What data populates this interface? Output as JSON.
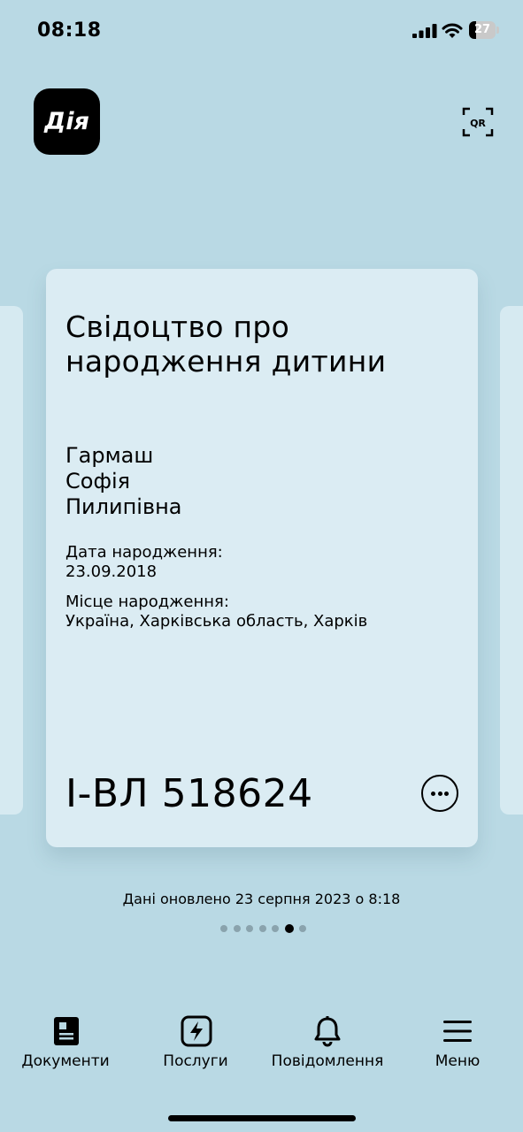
{
  "status_bar": {
    "time": "08:18",
    "battery": "27",
    "battery_level": 0.27
  },
  "header": {
    "logo_text": "Дія",
    "qr_label": "QR"
  },
  "document": {
    "title": "Свідоцтво про народження дитини",
    "surname": "Гармаш",
    "first_name": "Софія",
    "patronymic": "Пилипівна",
    "birth_date_label": "Дата народження:",
    "birth_date": "23.09.2018",
    "birth_place_label": "Місце народження:",
    "birth_place": "Україна, Харківська область, Харків",
    "number": "І-ВЛ 518624"
  },
  "updated_text": "Дані оновлено 23 серпня 2023 о 8:18",
  "pager": {
    "count": 7,
    "active_index": 5
  },
  "nav": {
    "items": [
      {
        "label": "Документи",
        "icon": "documents-icon"
      },
      {
        "label": "Послуги",
        "icon": "lightning-icon"
      },
      {
        "label": "Повідомлення",
        "icon": "bell-icon"
      },
      {
        "label": "Меню",
        "icon": "menu-icon"
      }
    ]
  }
}
